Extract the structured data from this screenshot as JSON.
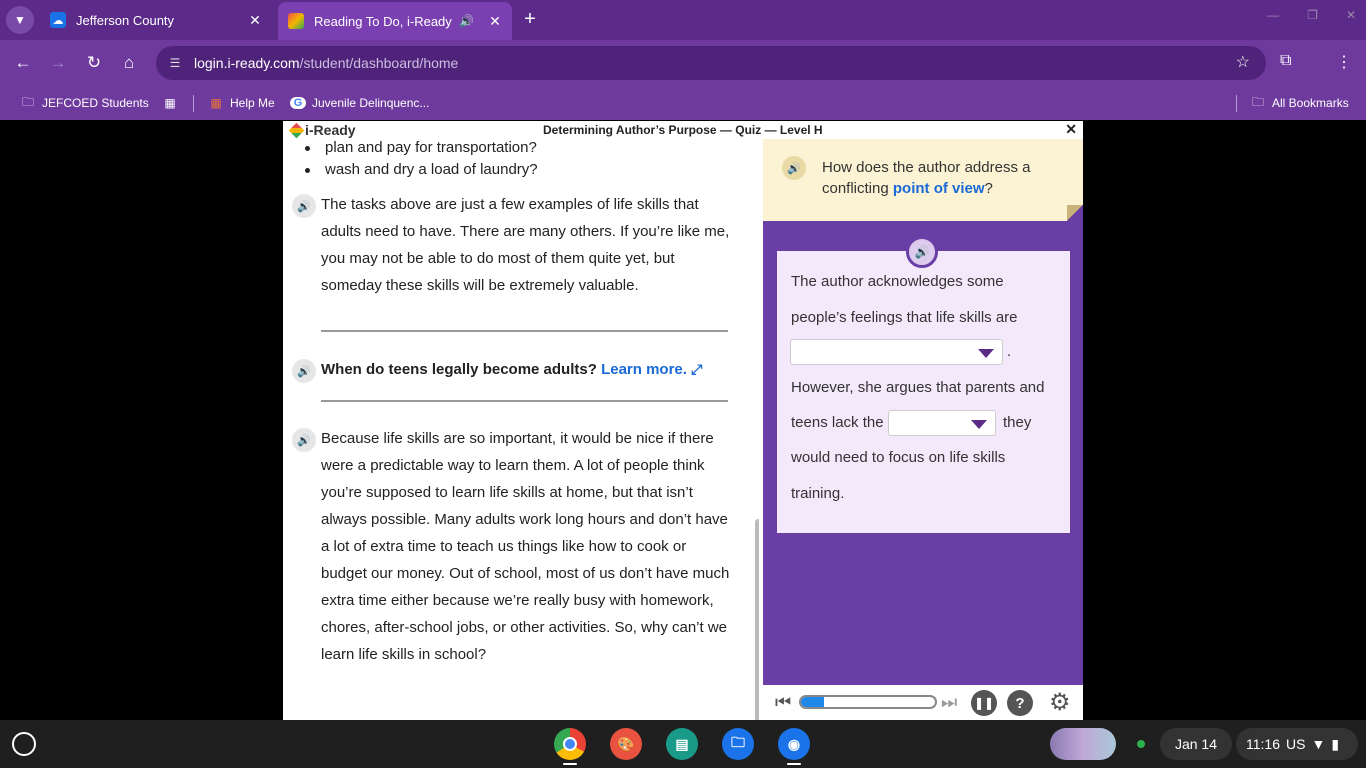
{
  "browser": {
    "tabs": [
      {
        "title": "Jefferson County",
        "favicon": "cloud-icon",
        "close": "✕"
      },
      {
        "title": "Reading To Do, i-Ready",
        "favicon": "iready-cube-icon",
        "close": "✕"
      }
    ],
    "url_host": "login.i-ready.com",
    "url_path": "/student/dashboard/home",
    "bookmarks": [
      {
        "label": "JEFCOED Students",
        "icon": "folder-icon"
      },
      {
        "label": "Help Me",
        "icon": "grid-icon"
      },
      {
        "label": "Juvenile Delinquenc...",
        "icon": "google-icon"
      }
    ],
    "all_bookmarks": "All Bookmarks"
  },
  "lesson": {
    "logo": "i-Ready",
    "title": "Determining Author’s Purpose — Quiz — Level H",
    "bullets": [
      "plan and pay for transportation?",
      "wash and dry a load of laundry?"
    ],
    "para1": "The tasks above are just a few examples of life skills that adults need to have. There are many others. If you’re like me, you may not be able to do most of them quite yet, but someday these skills will be extremely valuable.",
    "teen_question": "When do teens legally become adults?",
    "learn_more": "Learn more.",
    "para2": "Because life skills are so important, it would be nice if there were a predictable way to learn them. A lot of people think you’re supposed to learn life skills at home, but that isn’t always possible. Many adults work long hours and don’t have a lot of extra time to teach us things like how to cook or budget our money. Out of school, most of us don’t have much extra time either because we’re really busy with homework, chores, after-school jobs, or other activities. So, why can’t we learn life skills in school?"
  },
  "quiz": {
    "question_pre": "How does the author address a conflicting",
    "question_link": "point of view",
    "question_post": "?",
    "answer": {
      "line1": "The author acknowledges some",
      "line2": "people’s feelings that life skills are",
      "period": ".",
      "line3": "However, she argues that parents and",
      "line4_pre": "teens lack the",
      "line4_post": "they",
      "line5": "would need to focus on life skills",
      "line6": "training."
    },
    "player_progress": 0.17
  },
  "shelf": {
    "date": "Jan 14",
    "time": "11:16",
    "locale": "US"
  }
}
